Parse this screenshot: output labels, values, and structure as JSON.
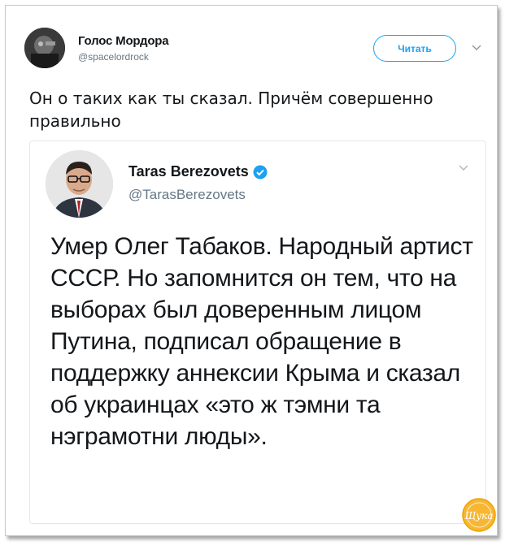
{
  "tweet": {
    "author_name": "Голос Мордора",
    "author_handle": "@spacelordrock",
    "follow_label": "Читать",
    "text": "Он о таких как ты сказал. Причём совершенно правильно"
  },
  "quoted_tweet": {
    "author_name": "Taras Berezovets",
    "author_handle": "@TarasBerezovets",
    "verified": true,
    "text": "Умер Олег Табаков. Народный артист СССР. Но запомнится он тем, что на выборах был доверенным лицом Путина, подписал обращение в поддержку аннексии Крыма и сказал об украинцах «это ж тэмни та нэграмотни люды»."
  },
  "watermark": {
    "text": "Щука"
  },
  "colors": {
    "accent": "#1da1f2",
    "text": "#14171a",
    "secondary": "#657786",
    "watermark": "#f5a623"
  },
  "icons": {
    "outer_avatar": "avatar-photo",
    "quote_avatar": "avatar-photo",
    "verified": "verified-badge-icon",
    "menu": "chevron-down-icon"
  }
}
